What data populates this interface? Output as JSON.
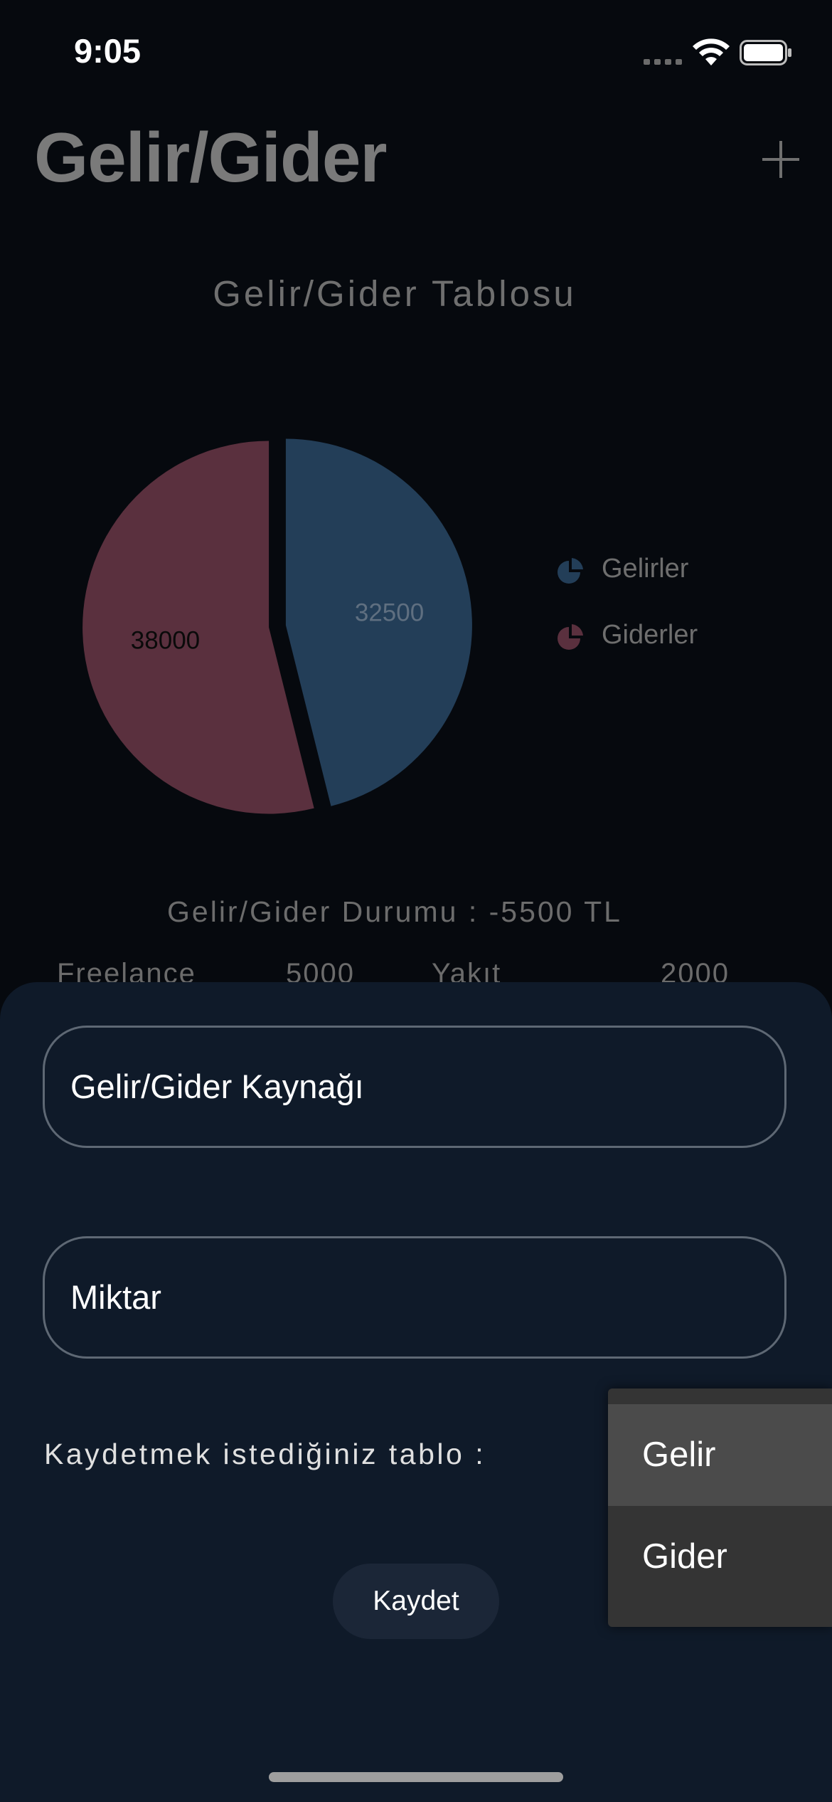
{
  "status_bar": {
    "time": "9:05"
  },
  "header": {
    "title": "Gelir/Gider"
  },
  "chart_data": {
    "type": "pie",
    "title": "Gelir/Gider Tablosu",
    "slices": [
      {
        "label": "Gelirler",
        "value": 32500,
        "color": "#233e58"
      },
      {
        "label": "Giderler",
        "value": 38000,
        "color": "#5a303e"
      }
    ],
    "legend_position": "right"
  },
  "balance": {
    "text": "Gelir/Gider Durumu : -5500 TL"
  },
  "peek": {
    "income_source": "Freelance",
    "income_amount": "5000",
    "expense_source": "Yakıt",
    "expense_amount": "2000"
  },
  "form": {
    "source_placeholder": "Gelir/Gider Kaynağı",
    "amount_placeholder": "Miktar",
    "table_prompt": "Kaydetmek istediğiniz tablo :",
    "save_label": "Kaydet"
  },
  "dropdown": {
    "options": [
      "Gelir",
      "Gider"
    ],
    "selected": "Gelir"
  },
  "colors": {
    "background": "#06090e",
    "sheet": "#0f1a29",
    "income": "#233e58",
    "expense": "#5a303e"
  }
}
